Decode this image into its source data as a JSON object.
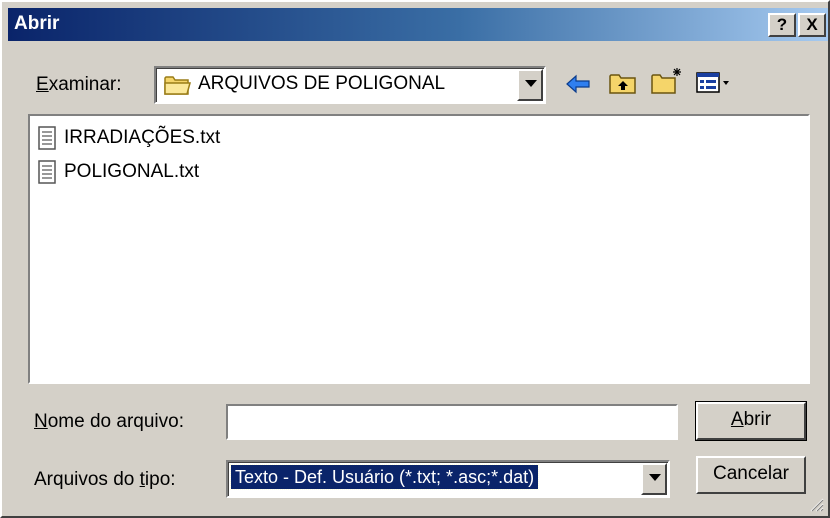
{
  "dialog": {
    "title": "Abrir",
    "help_label": "?",
    "close_label": "X"
  },
  "look_in": {
    "label": "Examinar:",
    "value": "ARQUIVOS DE POLIGONAL"
  },
  "toolbar": {
    "icons": [
      "back-arrow-icon",
      "up-folder-icon",
      "new-folder-icon",
      "view-menu-icon"
    ]
  },
  "files": [
    {
      "name": "IRRADIAÇÕES.txt",
      "icon": "text-file-icon"
    },
    {
      "name": "POLIGONAL.txt",
      "icon": "text-file-icon"
    }
  ],
  "filename": {
    "label": "Nome do arquivo:",
    "value": ""
  },
  "filetype": {
    "label": "Arquivos do tipo:",
    "value": "Texto - Def. Usuário (*.txt; *.asc;*.dat)"
  },
  "buttons": {
    "open": "Abrir",
    "cancel": "Cancelar"
  },
  "colors": {
    "title_bar_start": "#0a246a",
    "title_bar_end": "#a6caf0",
    "selection": "#0a246a",
    "face": "#d4d0c8"
  }
}
